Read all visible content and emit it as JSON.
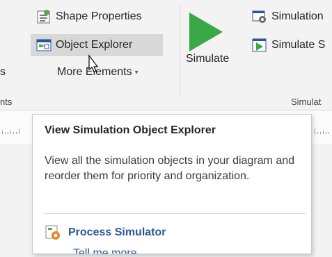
{
  "ribbon": {
    "shape_properties_label": "Shape Properties",
    "object_explorer_label": "Object Explorer",
    "more_elements_label": "More Elements",
    "more_elements_arrow": "▾",
    "left_cut_label": "s",
    "simulate_label": "Simulate",
    "simulation_top_label": "Simulation",
    "simulate_small_label": "Simulate S",
    "group_left_label": "nts",
    "group_sim_label": "Simulat"
  },
  "tooltip": {
    "title": "View Simulation Object Explorer",
    "description": "View all the simulation objects in your diagram and reorder them for priority and organization.",
    "addin_name": "Process Simulator",
    "tell_more": "Tell me more"
  },
  "colors": {
    "accent_blue": "#2b579a",
    "play_green": "#3aa845",
    "ribbon_bg": "#f3f3f3"
  }
}
